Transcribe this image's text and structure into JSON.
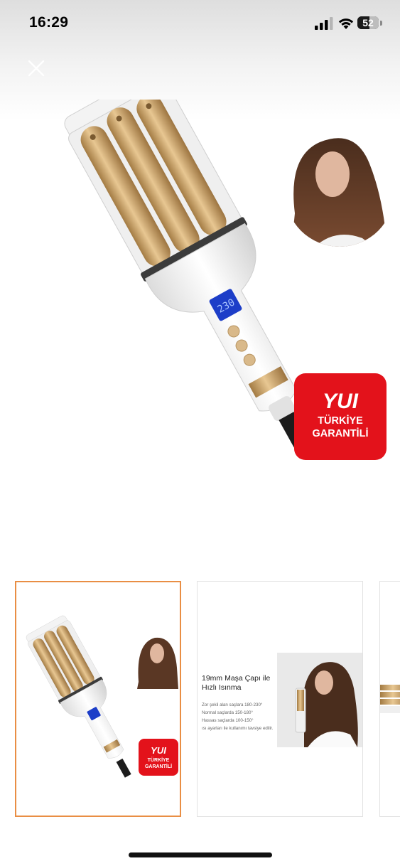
{
  "status_bar": {
    "time": "16:29",
    "battery_level": "52"
  },
  "main": {
    "badge": {
      "brand": "YUI",
      "line1": "TÜRKİYE",
      "line2": "GARANTİLİ"
    },
    "display_value": "230"
  },
  "thumbnails": [
    {
      "badge": {
        "brand": "YUI",
        "line1": "TÜRKİYE",
        "line2": "GARANTİLİ"
      }
    },
    {
      "title": "19mm Maşa Çapı ile Hızlı Isınma",
      "lines": [
        "Zor şekil alan saçlara 180-230°",
        "Normal saçlarda 150-180°",
        "Hassas saçlarda 100-150°",
        "ısı ayarları ile kullanımı tavsiye edilir."
      ]
    },
    {}
  ],
  "colors": {
    "accent_border": "#e98e44",
    "badge_red": "#e3121b",
    "barrel_gold": "#c9a064"
  }
}
